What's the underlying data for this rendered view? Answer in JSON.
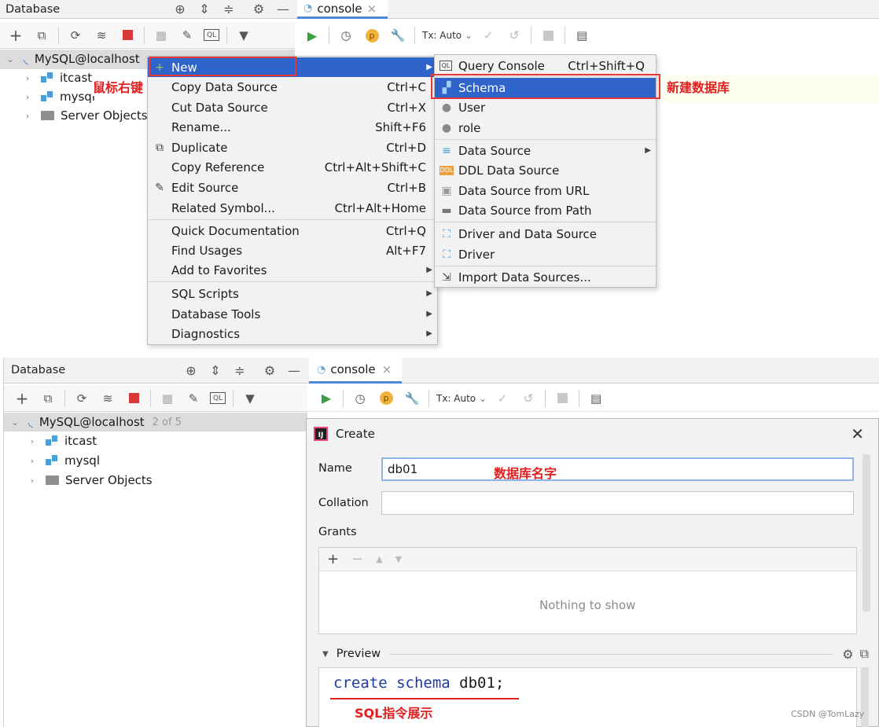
{
  "top": {
    "db_panel": {
      "title": "Database"
    },
    "console_tab": {
      "label": "console",
      "close": "×"
    },
    "tx_label": "Tx: Auto",
    "tree": {
      "root": {
        "label": "MySQL@localhost"
      },
      "items": [
        {
          "label": "itcast"
        },
        {
          "label": "mysql"
        },
        {
          "label": "Server Objects"
        }
      ]
    },
    "context_menu": {
      "items": [
        {
          "label": "New",
          "shortcut": "",
          "arrow": "▶",
          "icon": "+"
        },
        {
          "label": "Copy Data Source",
          "shortcut": "Ctrl+C"
        },
        {
          "label": "Cut Data Source",
          "shortcut": "Ctrl+X"
        },
        {
          "label": "Rename...",
          "shortcut": "Shift+F6"
        },
        {
          "label": "Duplicate",
          "shortcut": "Ctrl+D"
        },
        {
          "label": "Copy Reference",
          "shortcut": "Ctrl+Alt+Shift+C"
        },
        {
          "label": "Edit Source",
          "shortcut": "Ctrl+B"
        },
        {
          "label": "Related Symbol...",
          "shortcut": "Ctrl+Alt+Home"
        },
        {
          "label": "Quick Documentation",
          "shortcut": "Ctrl+Q"
        },
        {
          "label": "Find Usages",
          "shortcut": "Alt+F7"
        },
        {
          "label": "Add to Favorites",
          "shortcut": ""
        },
        {
          "label": "SQL Scripts",
          "shortcut": ""
        },
        {
          "label": "Database Tools",
          "shortcut": ""
        },
        {
          "label": "Diagnostics",
          "shortcut": ""
        }
      ]
    },
    "submenu": {
      "items": [
        {
          "label": "Query Console",
          "shortcut": "Ctrl+Shift+Q"
        },
        {
          "label": "Schema",
          "shortcut": ""
        },
        {
          "label": "User",
          "shortcut": ""
        },
        {
          "label": "role",
          "shortcut": ""
        },
        {
          "label": "Data Source",
          "shortcut": ""
        },
        {
          "label": "DDL Data Source",
          "shortcut": ""
        },
        {
          "label": "Data Source from URL",
          "shortcut": ""
        },
        {
          "label": "Data Source from Path",
          "shortcut": ""
        },
        {
          "label": "Driver and Data Source",
          "shortcut": ""
        },
        {
          "label": "Driver",
          "shortcut": ""
        },
        {
          "label": "Import Data Sources...",
          "shortcut": ""
        }
      ]
    },
    "annotations": {
      "right_click": "鼠标右键",
      "new_db": "新建数据库"
    }
  },
  "bottom": {
    "db_panel": {
      "title": "Database"
    },
    "console_tab": {
      "label": "console",
      "close": "×"
    },
    "tx_label": "Tx: Auto",
    "tree": {
      "root": {
        "label": "MySQL@localhost",
        "count": "2 of 5"
      },
      "items": [
        {
          "label": "itcast"
        },
        {
          "label": "mysql"
        },
        {
          "label": "Server Objects"
        }
      ]
    },
    "dialog": {
      "title": "Create",
      "name_label": "Name",
      "name_value": "db01",
      "collation_label": "Collation",
      "collation_value": "",
      "grants_label": "Grants",
      "empty_text": "Nothing to show",
      "preview_label": "Preview",
      "sql_kw1": "create",
      "sql_kw2": "schema",
      "sql_rest": " db01;"
    },
    "annotations": {
      "db_name": "数据库名字",
      "sql_show": "SQL指令展示"
    }
  },
  "watermark": "CSDN @TomLazy",
  "colors": {
    "selection": "#2f65ca",
    "annotation": "#e02020",
    "run": "#3aa040",
    "stop": "#d93838",
    "keyword": "#1a3aa6"
  }
}
